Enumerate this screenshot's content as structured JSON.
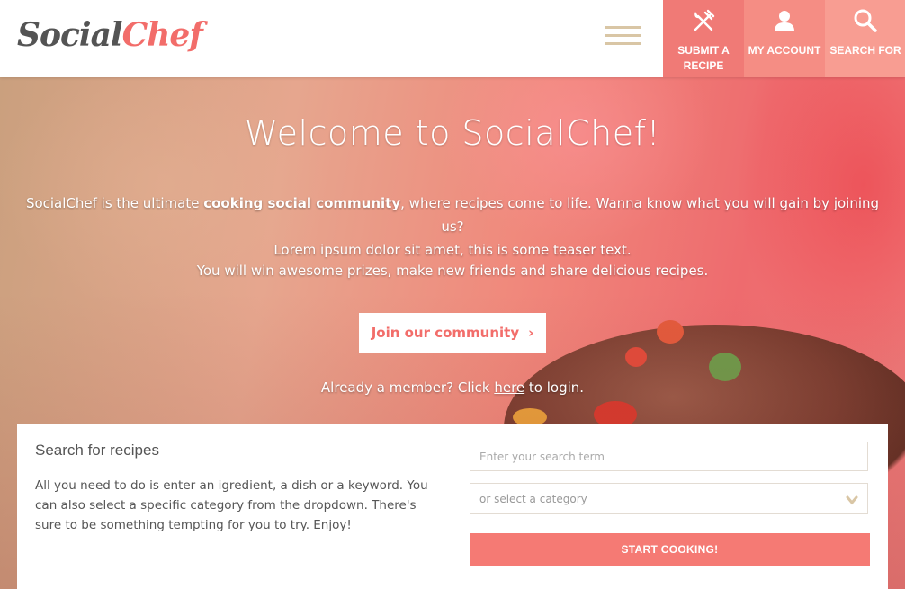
{
  "header": {
    "logo_part1": "Social",
    "logo_part2": "Chef",
    "nav": [
      {
        "label": "SUBMIT A RECIPE",
        "icon": "fork-knife-icon"
      },
      {
        "label": "MY ACCOUNT",
        "icon": "user-icon"
      },
      {
        "label": "SEARCH FOR",
        "icon": "search-icon"
      }
    ]
  },
  "hero": {
    "title": "Welcome to SocialChef!",
    "intro_before": "SocialChef is the ultimate ",
    "intro_bold": "cooking social community",
    "intro_after": ", where recipes come to life. Wanna know what you will gain by joining us?",
    "intro_line2": "Lorem ipsum dolor sit amet, this is some teaser text.",
    "prizes": "You will win awesome prizes, make new friends and share delicious recipes.",
    "join_button": "Join our community",
    "login_before": "Already a member? Click ",
    "login_link": "here",
    "login_after": " to login."
  },
  "search": {
    "title": "Search for recipes",
    "description": "All you need to do is enter an igredient, a dish or a keyword. You can also select a specific category from the dropdown. There's sure to be something tempting for you to try. Enjoy!",
    "placeholder": "Enter your search term",
    "category_value": "or select a category",
    "button": "START COOKING!"
  },
  "colors": {
    "accent": "#f26d6a",
    "nav1": "#f07a76",
    "nav2": "#f58d84",
    "nav3": "#f89d92",
    "hamburger": "#d9c6a5"
  }
}
